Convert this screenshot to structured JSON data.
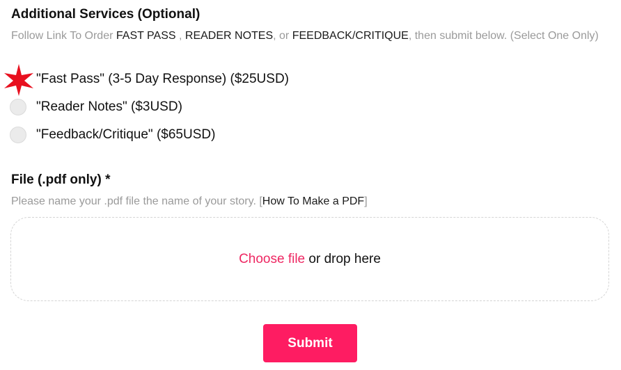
{
  "services": {
    "title": "Additional Services (Optional)",
    "help_prefix": "Follow Link To Order ",
    "link_fast_pass": "FAST PASS",
    "sep1": " , ",
    "link_reader_notes": "READER NOTES",
    "sep2": ", or ",
    "link_feedback": "FEEDBACK/CRITIQUE",
    "help_suffix": ", then submit below. (Select One Only)",
    "options": [
      {
        "label": "\"Fast Pass\" (3-5 Day Response) ($25USD)",
        "selected": false
      },
      {
        "label": "\"Reader Notes\" ($3USD)",
        "selected": false
      },
      {
        "label": "\"Feedback/Critique\" ($65USD)",
        "selected": false
      }
    ],
    "marker_color": "#e8101f"
  },
  "file": {
    "title": "File (.pdf only) *",
    "help_prefix": "Please name your .pdf file the name of your story. [",
    "help_link": "How To Make a PDF",
    "help_suffix": "]",
    "choose_label": "Choose file",
    "drop_label": " or drop here"
  },
  "submit": {
    "label": "Submit",
    "color": "#fe1c62"
  }
}
